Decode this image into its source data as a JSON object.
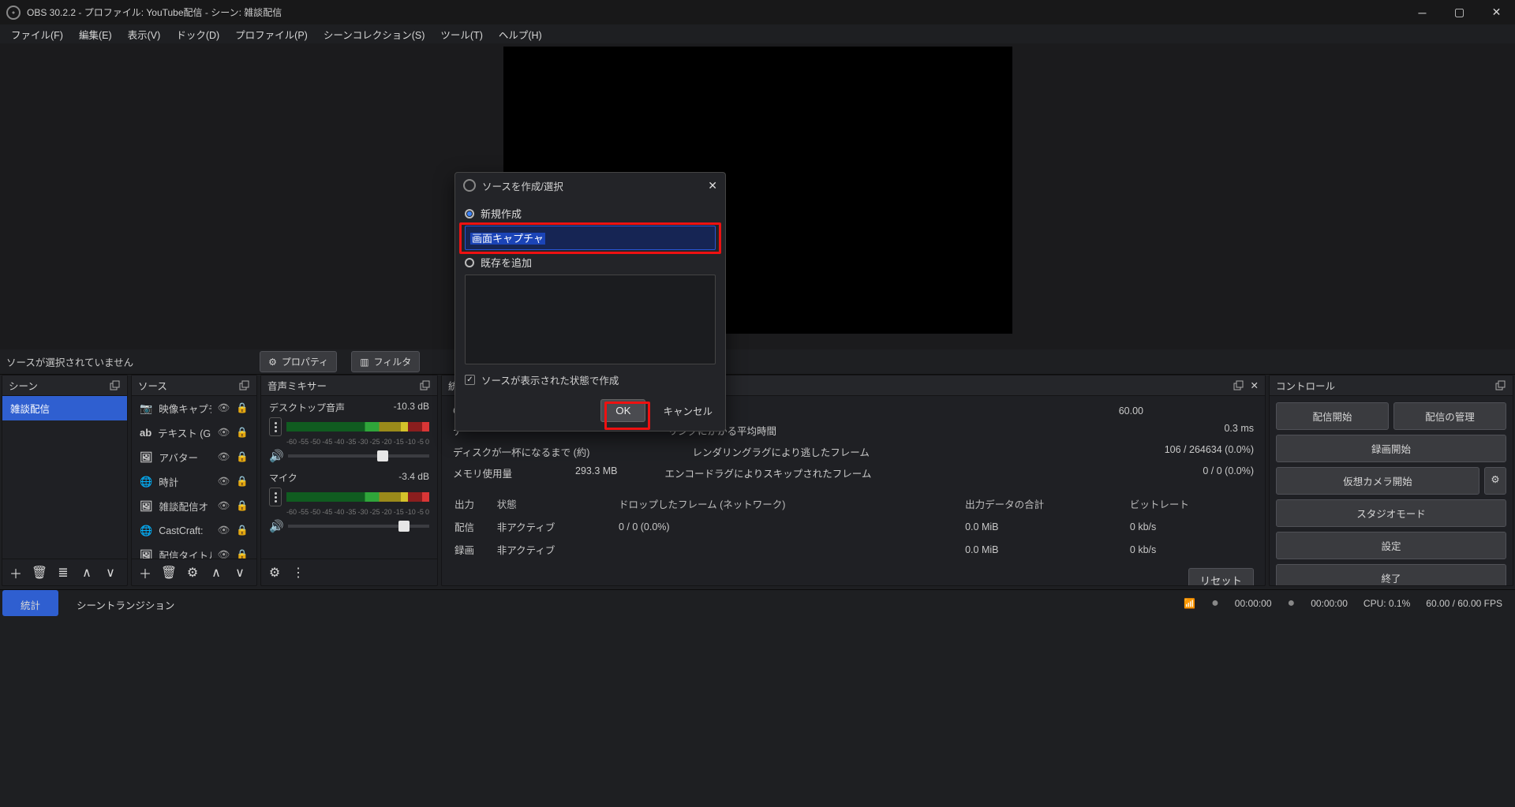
{
  "titlebar": {
    "text": "OBS 30.2.2 - プロファイル: YouTube配信 - シーン: 雑談配信"
  },
  "menu": {
    "items": [
      "ファイル(F)",
      "編集(E)",
      "表示(V)",
      "ドック(D)",
      "プロファイル(P)",
      "シーンコレクション(S)",
      "ツール(T)",
      "ヘルプ(H)"
    ]
  },
  "under_preview": {
    "no_source": "ソースが選択されていません",
    "properties": "プロパティ",
    "filters": "フィルタ"
  },
  "docks": {
    "scenes": {
      "title": "シーン",
      "items": [
        "雑談配信"
      ]
    },
    "sources": {
      "title": "ソース",
      "items": [
        {
          "icon": "camera",
          "label": "映像キャプチ"
        },
        {
          "icon": "ab",
          "label": "テキスト (GD"
        },
        {
          "icon": "image",
          "label": "アバター"
        },
        {
          "icon": "globe",
          "label": "時計"
        },
        {
          "icon": "image",
          "label": "雑談配信オ"
        },
        {
          "icon": "globe",
          "label": "CastCraft:"
        },
        {
          "icon": "image",
          "label": "配信タイトル"
        }
      ]
    },
    "mixer": {
      "title": "音声ミキサー",
      "channels": [
        {
          "name": "デスクトップ音声",
          "db": "-10.3 dB",
          "thumb_pct": 63
        },
        {
          "name": "マイク",
          "db": "-3.4 dB",
          "thumb_pct": 78
        }
      ],
      "ticks": [
        "-60",
        "-55",
        "-50",
        "-45",
        "-40",
        "-35",
        "-30",
        "-25",
        "-20",
        "-15",
        "-10",
        "-5",
        "0"
      ]
    },
    "stats": {
      "title": "統",
      "rows": {
        "fps_value": "60.00",
        "render_avg_label": "リングにかかる平均時間",
        "render_avg_value": "0.3 ms",
        "disk_label": "ディスクが一杯になるまで (約)",
        "render_lag_label": "レンダリングラグにより逃したフレーム",
        "render_lag_value": "106 / 264634 (0.0%)",
        "mem_label": "メモリ使用量",
        "mem_value": "293.3 MB",
        "encode_lag_label": "エンコードラグによりスキップされたフレーム",
        "encode_lag_value": "0 / 0 (0.0%)"
      },
      "table": {
        "headers": [
          "出力",
          "状態",
          "ドロップしたフレーム (ネットワーク)",
          "出力データの合計",
          "ビットレート"
        ],
        "rows": [
          [
            "配信",
            "非アクティブ",
            "0 / 0 (0.0%)",
            "0.0 MiB",
            "0 kb/s"
          ],
          [
            "録画",
            "非アクティブ",
            "",
            "0.0 MiB",
            "0 kb/s"
          ]
        ]
      },
      "reset": "リセット"
    },
    "controls": {
      "title": "コントロール",
      "start_stream": "配信開始",
      "manage_stream": "配信の管理",
      "start_record": "録画開始",
      "start_vcam": "仮想カメラ開始",
      "studio_mode": "スタジオモード",
      "settings": "設定",
      "exit": "終了"
    }
  },
  "bottom": {
    "tabs": [
      "統計",
      "シーントランジション"
    ]
  },
  "statusbar": {
    "time": "00:00:00",
    "cpu": "CPU: 0.1%",
    "fps": "60.00 / 60.00 FPS"
  },
  "modal": {
    "title": "ソースを作成/選択",
    "radio_new": "新規作成",
    "input_value": "画面キャプチャ",
    "radio_existing": "既存を追加",
    "make_visible": "ソースが表示された状態で作成",
    "ok": "OK",
    "cancel": "キャンセル"
  }
}
